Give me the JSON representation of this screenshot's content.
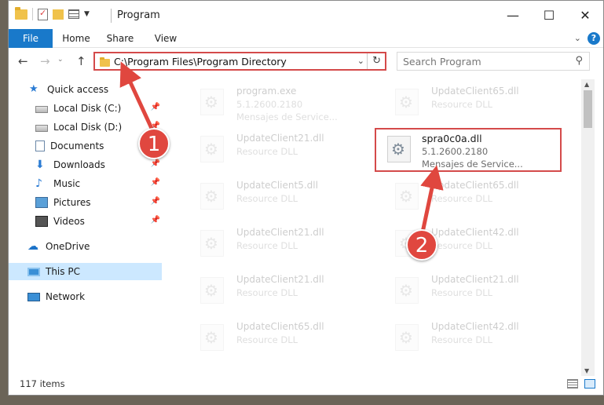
{
  "window": {
    "title": "Program",
    "controls": {
      "minimize": "—",
      "maximize": "☐",
      "close": "✕"
    }
  },
  "ribbon": {
    "tabs": [
      "File",
      "Home",
      "Share",
      "View"
    ],
    "help": "?"
  },
  "navigation": {
    "address": "C:\\Program Files\\Program Directory",
    "search_placeholder": "Search Program"
  },
  "sidebar": {
    "items": [
      {
        "label": "Quick access",
        "icon": "star-icon",
        "pinned": false
      },
      {
        "label": "Local Disk (C:)",
        "icon": "disk-icon",
        "pinned": true
      },
      {
        "label": "Local Disk (D:)",
        "icon": "disk-icon",
        "pinned": true
      },
      {
        "label": "Documents",
        "icon": "documents-icon",
        "pinned": true
      },
      {
        "label": "Downloads",
        "icon": "download-icon",
        "pinned": true
      },
      {
        "label": "Music",
        "icon": "music-icon",
        "pinned": true
      },
      {
        "label": "Pictures",
        "icon": "pictures-icon",
        "pinned": true
      },
      {
        "label": "Videos",
        "icon": "videos-icon",
        "pinned": true
      },
      {
        "label": "OneDrive",
        "icon": "onedrive-icon",
        "pinned": false
      },
      {
        "label": "This PC",
        "icon": "this-pc-icon",
        "pinned": false,
        "selected": true
      },
      {
        "label": "Network",
        "icon": "network-icon",
        "pinned": false
      }
    ]
  },
  "files": [
    {
      "name": "program.exe",
      "type": "5.1.2600.2180",
      "desc": "Mensajes de Service..."
    },
    {
      "name": "UpdateClient65.dll",
      "type": "Resource DLL",
      "desc": ""
    },
    {
      "name": "UpdateClient21.dll",
      "type": "Resource DLL",
      "desc": ""
    },
    {
      "name": "spra0c0a.dll",
      "type": "5.1.2600.2180",
      "desc": "Mensajes de Service...",
      "highlight": true
    },
    {
      "name": "UpdateClient5.dll",
      "type": "Resource DLL",
      "desc": ""
    },
    {
      "name": "UpdateClient65.dll",
      "type": "Resource DLL",
      "desc": ""
    },
    {
      "name": "UpdateClient21.dll",
      "type": "Resource DLL",
      "desc": ""
    },
    {
      "name": "UpdateClient42.dll",
      "type": "Resource DLL",
      "desc": ""
    },
    {
      "name": "UpdateClient21.dll",
      "type": "Resource DLL",
      "desc": ""
    },
    {
      "name": "UpdateClient21.dll",
      "type": "Resource DLL",
      "desc": ""
    },
    {
      "name": "UpdateClient65.dll",
      "type": "Resource DLL",
      "desc": ""
    },
    {
      "name": "UpdateClient42.dll",
      "type": "Resource DLL",
      "desc": ""
    }
  ],
  "status": {
    "item_count": "117 items"
  },
  "annotations": {
    "step1": "1",
    "step2": "2",
    "accent_color": "#e0473f"
  }
}
